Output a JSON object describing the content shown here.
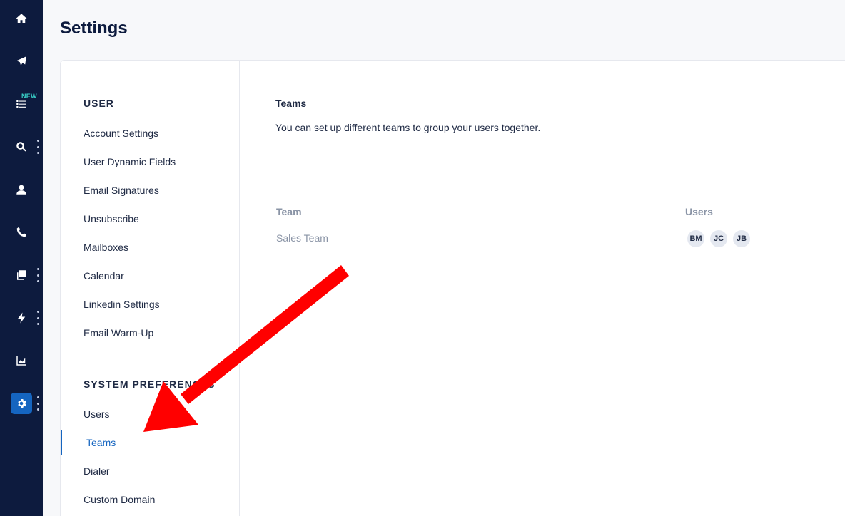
{
  "page": {
    "title": "Settings"
  },
  "rail": {
    "new_badge": "NEW",
    "items": [
      {
        "icon": "home-icon"
      },
      {
        "icon": "paper-plane-icon"
      },
      {
        "icon": "task-list-icon"
      },
      {
        "icon": "search-icon"
      },
      {
        "icon": "user-icon"
      },
      {
        "icon": "phone-icon"
      },
      {
        "icon": "copy-icon"
      },
      {
        "icon": "lightning-icon"
      },
      {
        "icon": "chart-icon"
      },
      {
        "icon": "gear-icon"
      }
    ]
  },
  "settings_nav": {
    "user_heading": "USER",
    "user_items": [
      "Account Settings",
      "User Dynamic Fields",
      "Email Signatures",
      "Unsubscribe",
      "Mailboxes",
      "Calendar",
      "Linkedin Settings",
      "Email Warm-Up"
    ],
    "system_heading": "SYSTEM PREFERENCES",
    "system_items": [
      "Users",
      "Teams",
      "Dialer",
      "Custom Domain"
    ],
    "active_item": "Teams"
  },
  "teams": {
    "title": "Teams",
    "description": "You can set up different teams to group your users together.",
    "columns": {
      "team": "Team",
      "users": "Users"
    },
    "rows": [
      {
        "name": "Sales Team",
        "users": [
          "BM",
          "JC",
          "JB"
        ]
      }
    ]
  },
  "colors": {
    "rail_bg": "#0d1b3e",
    "accent": "#1565c0",
    "annotation_arrow": "#ff0000"
  }
}
